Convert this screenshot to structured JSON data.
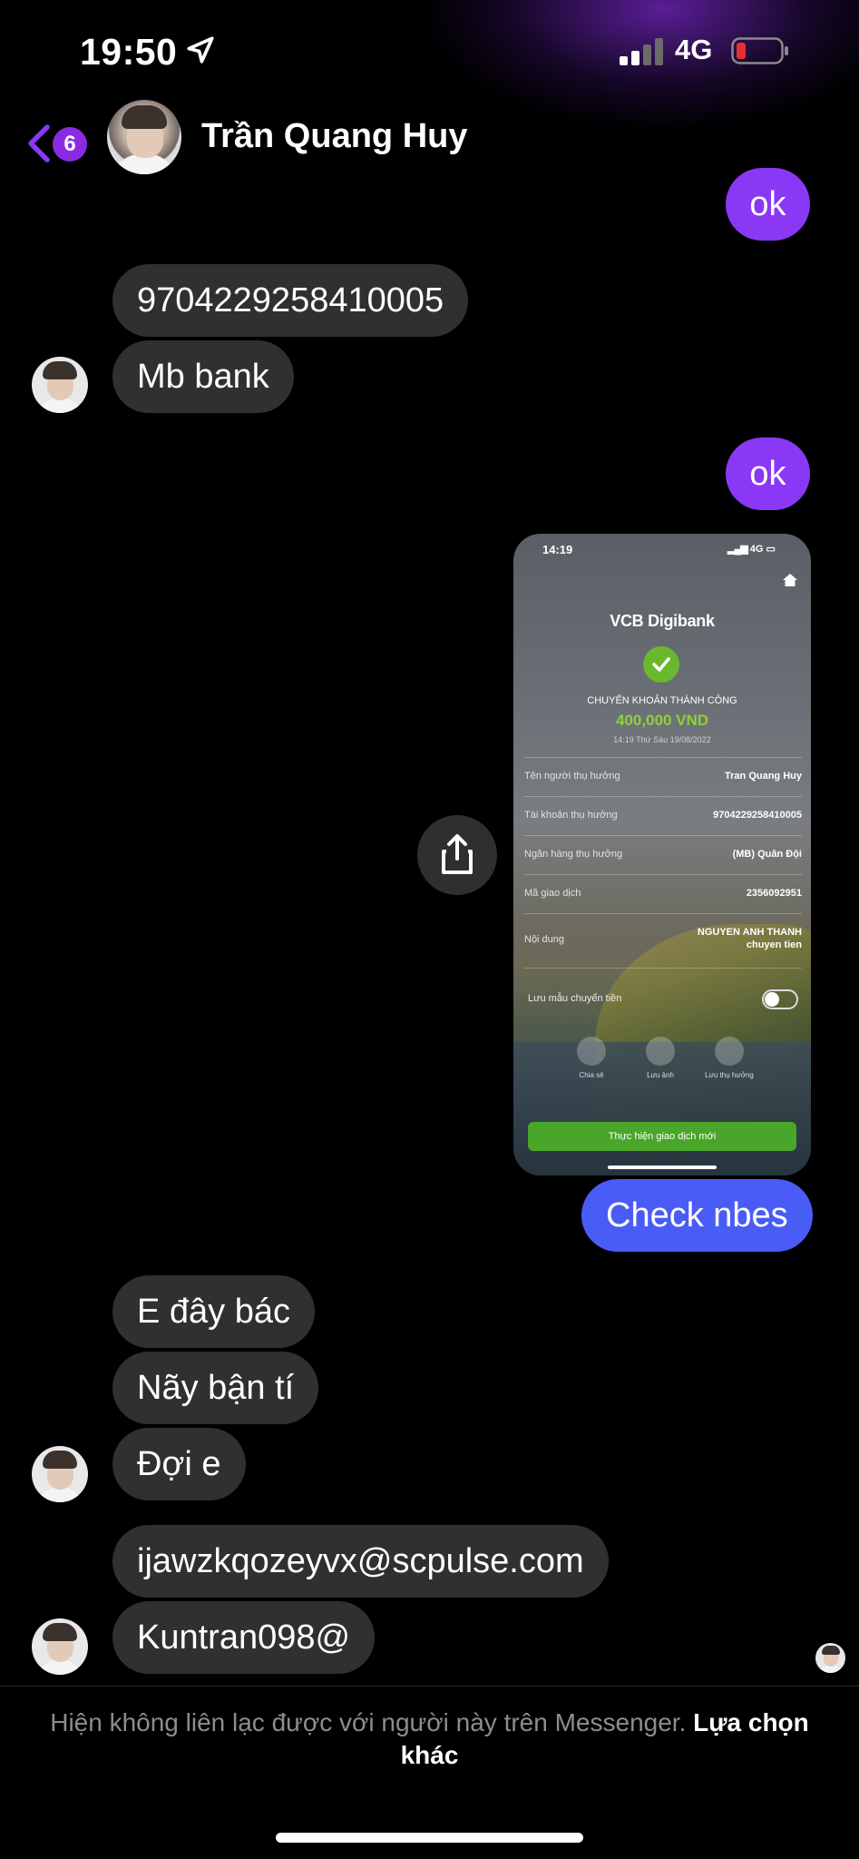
{
  "status_bar": {
    "time": "19:50",
    "network": "4G"
  },
  "header": {
    "back_badge": "6",
    "contact_name": "Trần Quang Huy"
  },
  "messages": [
    {
      "id": "m1",
      "direction": "out",
      "text": "ok",
      "color": "#8a38f5"
    },
    {
      "id": "m2",
      "direction": "in",
      "text": "9704229258410005"
    },
    {
      "id": "m3",
      "direction": "in",
      "text": "Mb bank"
    },
    {
      "id": "m4",
      "direction": "out",
      "text": "ok",
      "color": "#8a38f5"
    },
    {
      "id": "m5",
      "direction": "out",
      "type": "image"
    },
    {
      "id": "m6",
      "direction": "out",
      "text": "Check nbes",
      "color": "#4a5cf6"
    },
    {
      "id": "m7",
      "direction": "in",
      "text": "E đây bác"
    },
    {
      "id": "m8",
      "direction": "in",
      "text": "Nãy bận tí"
    },
    {
      "id": "m9",
      "direction": "in",
      "text": "Đợi e"
    },
    {
      "id": "m10",
      "direction": "in",
      "text": "ijawzkqozeyvx@scpulse.com"
    },
    {
      "id": "m11",
      "direction": "in",
      "text": "Kuntran098@"
    }
  ],
  "receipt": {
    "time": "14:19",
    "network": "4G",
    "logo": "VCB Digibank",
    "success_text": "CHUYỂN KHOẢN THÀNH CÔNG",
    "amount": "400,000 VND",
    "datetime": "14:19 Thứ Sáu 19/08/2022",
    "rows": [
      {
        "label": "Tên người thụ hưởng",
        "value": "Tran Quang Huy"
      },
      {
        "label": "Tài khoản thụ hưởng",
        "value": "9704229258410005"
      },
      {
        "label": "Ngân hàng thụ hưởng",
        "value": "(MB) Quân Đội"
      },
      {
        "label": "Mã giao dịch",
        "value": "2356092951"
      },
      {
        "label": "Nội dung",
        "value": "NGUYEN ANH THANH",
        "value2": "chuyen tien"
      }
    ],
    "save_template": "Lưu mẫu chuyển tiền",
    "actions": [
      "Chia sẻ",
      "Lưu ảnh",
      "Lưu thụ hưởng"
    ],
    "new_transaction_button": "Thực hiện giao dịch mới",
    "accent": "#6ab82c"
  },
  "footer": {
    "notice": "Hiện không liên lạc được với người này trên Messenger.",
    "link": "Lựa chọn khác"
  },
  "icons": {
    "back": "chevron-left-icon",
    "share": "share-icon",
    "location": "location-arrow-icon",
    "signal": "signal-icon",
    "battery": "battery-low-icon"
  },
  "colors": {
    "accent_purple": "#8a38f5",
    "accent_blue": "#4a5cf6",
    "incoming_bubble": "#303030",
    "battery_low": "#e5312f"
  }
}
